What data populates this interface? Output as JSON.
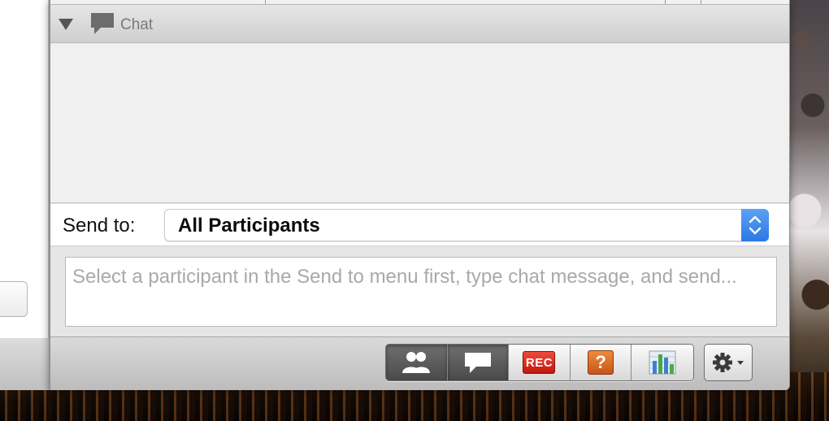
{
  "chat_panel": {
    "title": "Chat",
    "send_to": {
      "label": "Send to:",
      "selected": "All Participants"
    },
    "compose": {
      "placeholder": "Select a participant in the Send to menu first, type chat message, and send...",
      "value": ""
    }
  },
  "toolbar": {
    "buttons": [
      {
        "name": "participants",
        "icon": "participants-icon",
        "active": true
      },
      {
        "name": "chat",
        "icon": "chat-bubble-icon",
        "active": true
      },
      {
        "name": "record",
        "icon": "record-icon",
        "label": "REC"
      },
      {
        "name": "help",
        "icon": "help-icon",
        "label": "?"
      },
      {
        "name": "polling",
        "icon": "bar-chart-icon"
      }
    ],
    "settings": {
      "icon": "gear-icon"
    }
  },
  "colors": {
    "accent_blue": "#2b78e4",
    "rec_red": "#d8261a",
    "help_orange": "#e06a25"
  }
}
